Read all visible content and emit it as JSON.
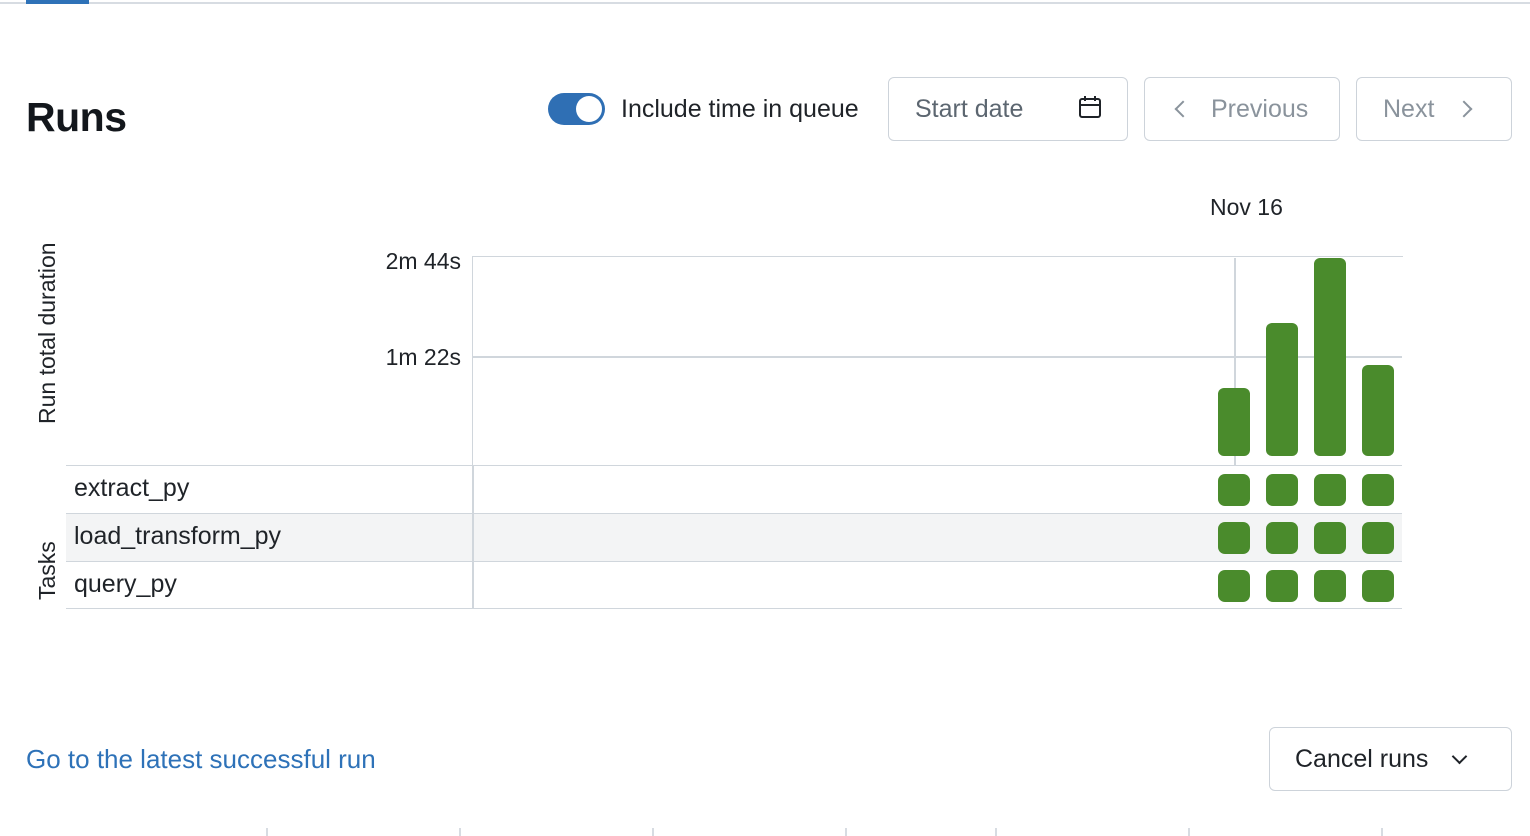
{
  "header": {
    "title": "Runs"
  },
  "controls": {
    "queue_toggle": {
      "label": "Include time in queue",
      "checked": true
    },
    "start_date": {
      "placeholder": "Start date",
      "icon": "calendar-icon"
    },
    "previous_label": "Previous",
    "next_label": "Next"
  },
  "chart": {
    "date_label": "Nov 16",
    "y_axis_label": "Run total duration",
    "y_ticks": [
      "2m 44s",
      "1m 22s"
    ],
    "tasks_label": "Tasks",
    "bar_color": "#4a8b2c"
  },
  "chart_data": {
    "type": "bar",
    "ylabel": "Run total duration",
    "y_unit": "seconds",
    "ylim": [
      0,
      164
    ],
    "y_tick_values": [
      82,
      164
    ],
    "categories": [
      "Nov 16",
      "Nov 16",
      "Nov 16",
      "Nov 16"
    ],
    "values": [
      56,
      110,
      164,
      75
    ],
    "tasks": [
      {
        "name": "extract_py",
        "statuses": [
          "success",
          "success",
          "success",
          "success"
        ]
      },
      {
        "name": "load_transform_py",
        "statuses": [
          "success",
          "success",
          "success",
          "success"
        ]
      },
      {
        "name": "query_py",
        "statuses": [
          "success",
          "success",
          "success",
          "success"
        ]
      }
    ]
  },
  "footer": {
    "latest_link": "Go to the latest successful run",
    "cancel_label": "Cancel runs"
  }
}
